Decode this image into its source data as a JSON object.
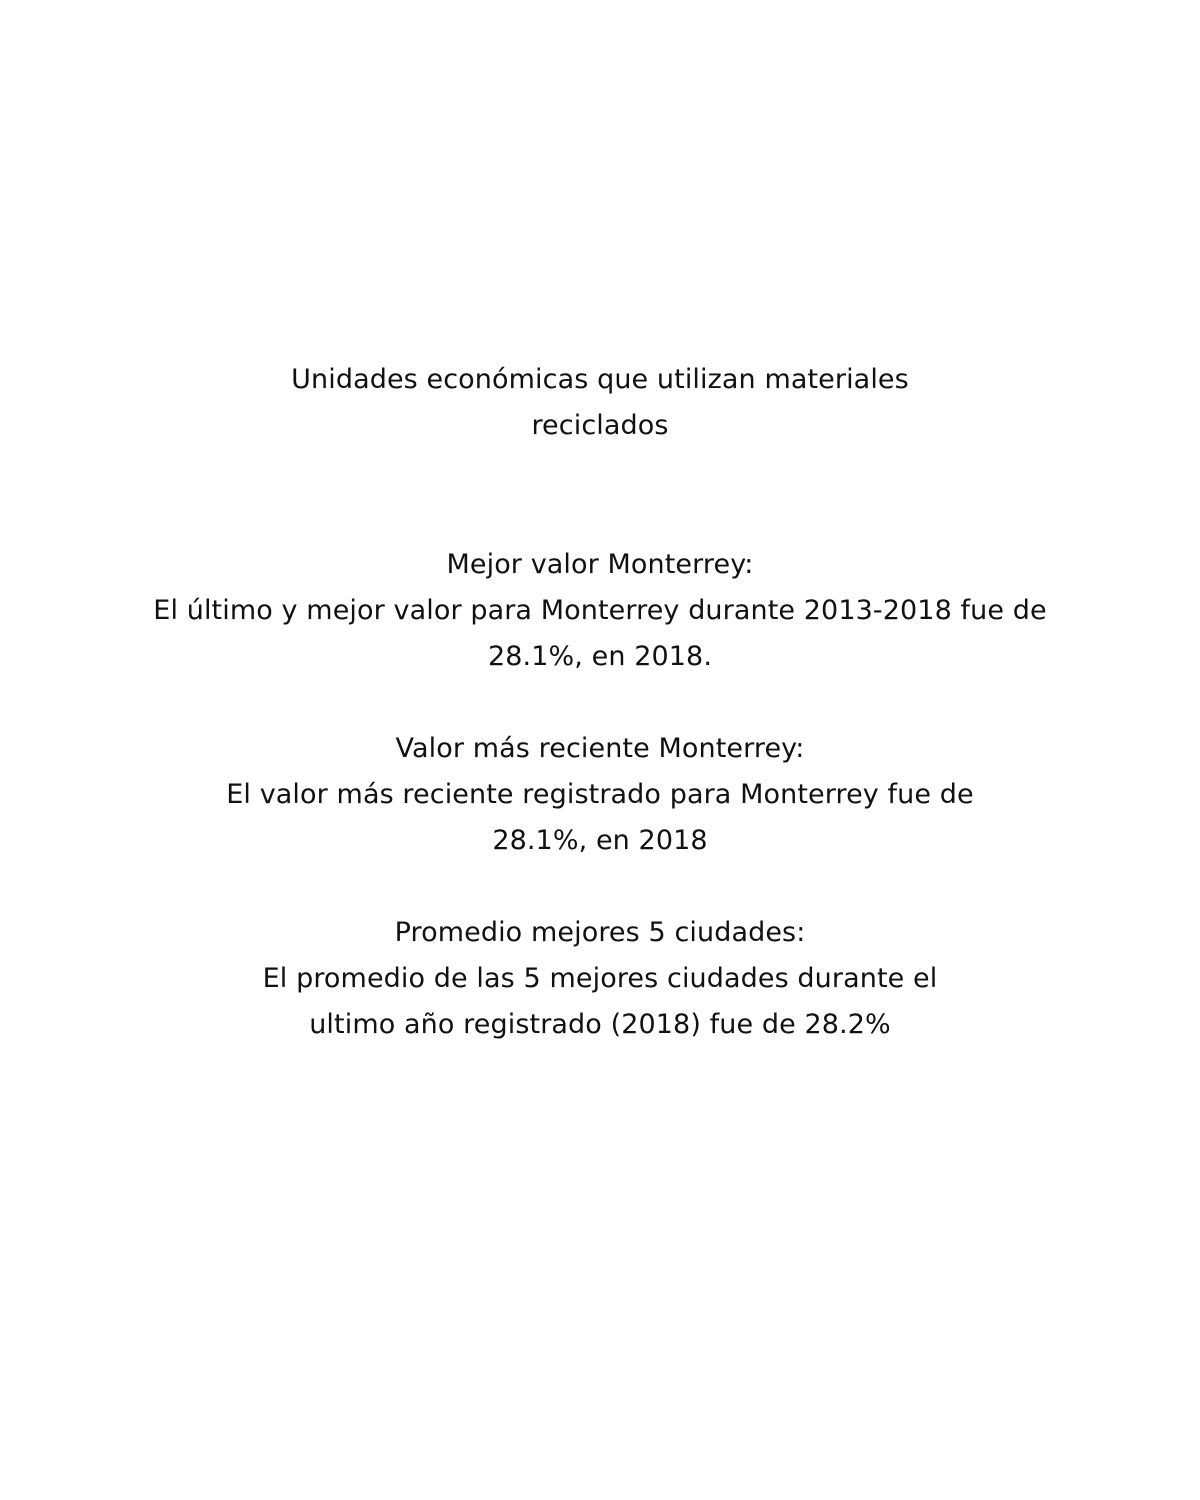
{
  "title": {
    "line1": "Unidades económicas que utilizan materiales",
    "line2": "reciclados"
  },
  "sections": [
    {
      "heading": "Mejor valor Monterrey:",
      "body_line1": "El último y mejor valor para Monterrey durante 2013-2018 fue de",
      "body_line2": "28.1%, en 2018."
    },
    {
      "heading": "Valor más reciente Monterrey:",
      "body_line1": "El valor más reciente registrado para Monterrey fue de",
      "body_line2": "28.1%, en 2018"
    },
    {
      "heading": "Promedio mejores 5 ciudades:",
      "body_line1": "El promedio de las 5 mejores ciudades durante el",
      "body_line2": "ultimo año registrado (2018) fue de 28.2%"
    }
  ]
}
